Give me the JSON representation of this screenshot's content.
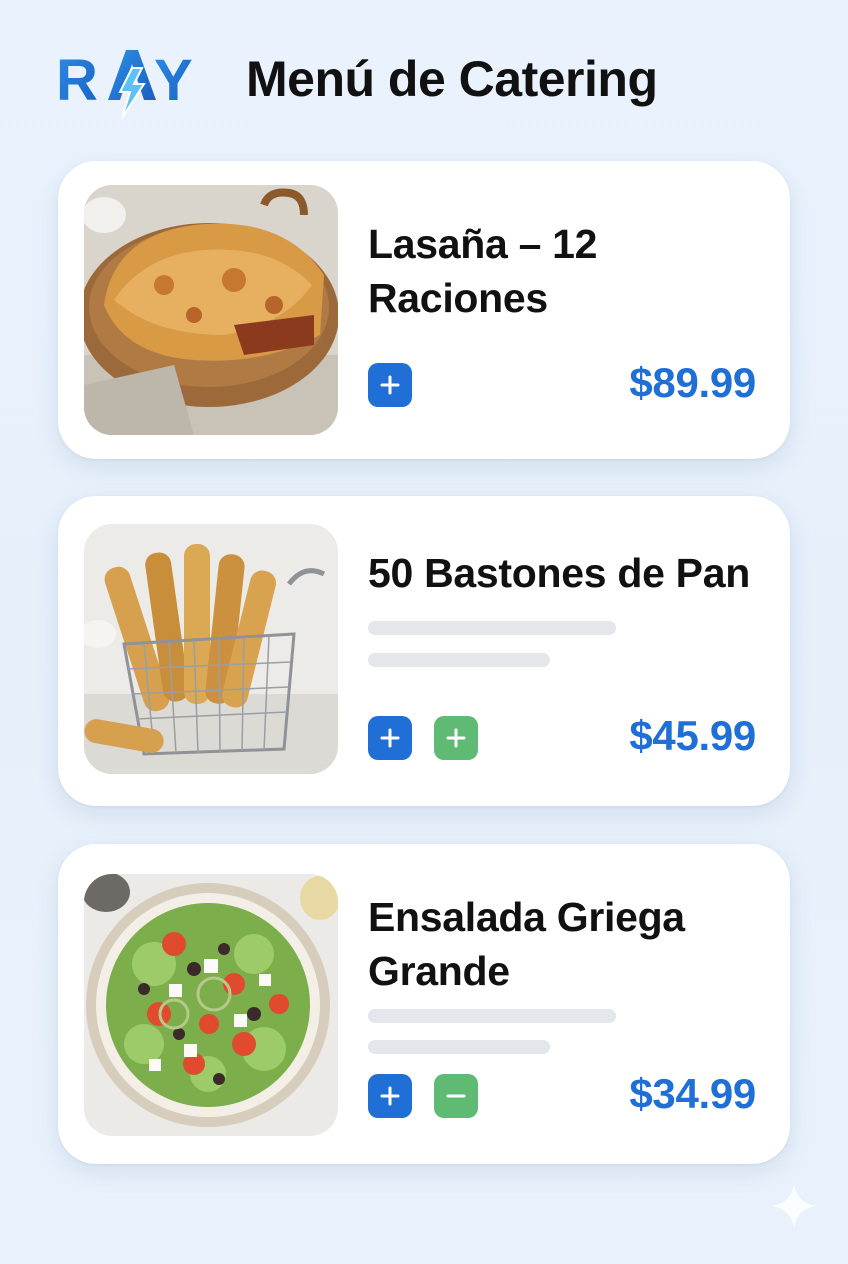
{
  "header": {
    "logo_text": "RAY",
    "title": "Menú de Catering"
  },
  "colors": {
    "accent": "#1f6fd6",
    "secondary": "#5fba74",
    "placeholder": "#e3e6ea"
  },
  "items": [
    {
      "name_line1": "Lasaña – 12",
      "name_line2": "Raciones",
      "price": "$89.99",
      "image": "lasagna-pan",
      "buttons": [
        "plus-icon"
      ]
    },
    {
      "name_line1": "50 Bastones de Pan",
      "price": "$45.99",
      "image": "breadsticks-basket",
      "buttons": [
        "plus-icon",
        "plus-icon"
      ]
    },
    {
      "name_line1": "Ensalada Griega",
      "name_line2": "Grande",
      "price": "$34.99",
      "image": "greek-salad-bowl",
      "buttons": [
        "plus-icon",
        "minus-icon"
      ]
    }
  ]
}
